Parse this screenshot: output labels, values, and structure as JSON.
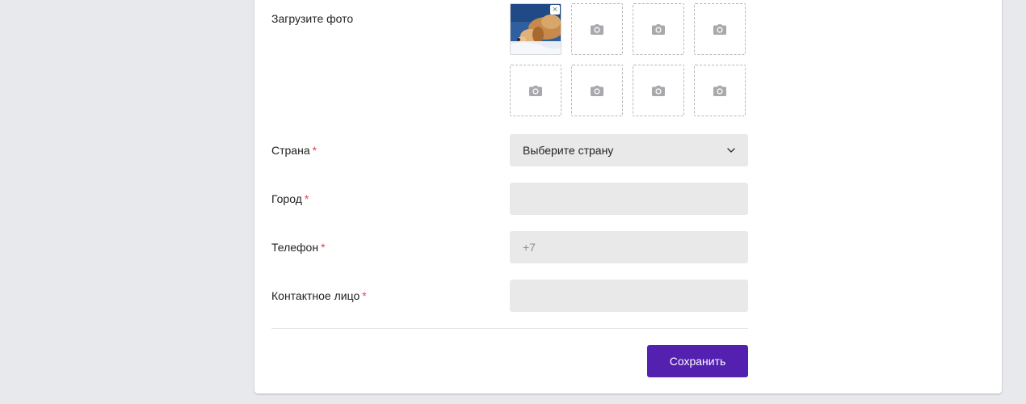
{
  "form": {
    "photo": {
      "label": "Загрузите фото",
      "remove_glyph": "×",
      "uploaded_count": 1,
      "total_slots": 8,
      "camera_icon": "camera-icon"
    },
    "country": {
      "label": "Страна",
      "required_mark": "*",
      "value": "Выберите страну"
    },
    "city": {
      "label": "Город",
      "required_mark": "*",
      "value": ""
    },
    "phone": {
      "label": "Телефон",
      "required_mark": "*",
      "placeholder": "+7",
      "value": ""
    },
    "contact": {
      "label": "Контактное лицо",
      "required_mark": "*",
      "value": ""
    }
  },
  "actions": {
    "save_label": "Сохранить"
  },
  "colors": {
    "accent": "#5420b0",
    "required": "#e0454d",
    "input_bg": "#e9e9e9",
    "page_bg": "#e8e9ed"
  }
}
